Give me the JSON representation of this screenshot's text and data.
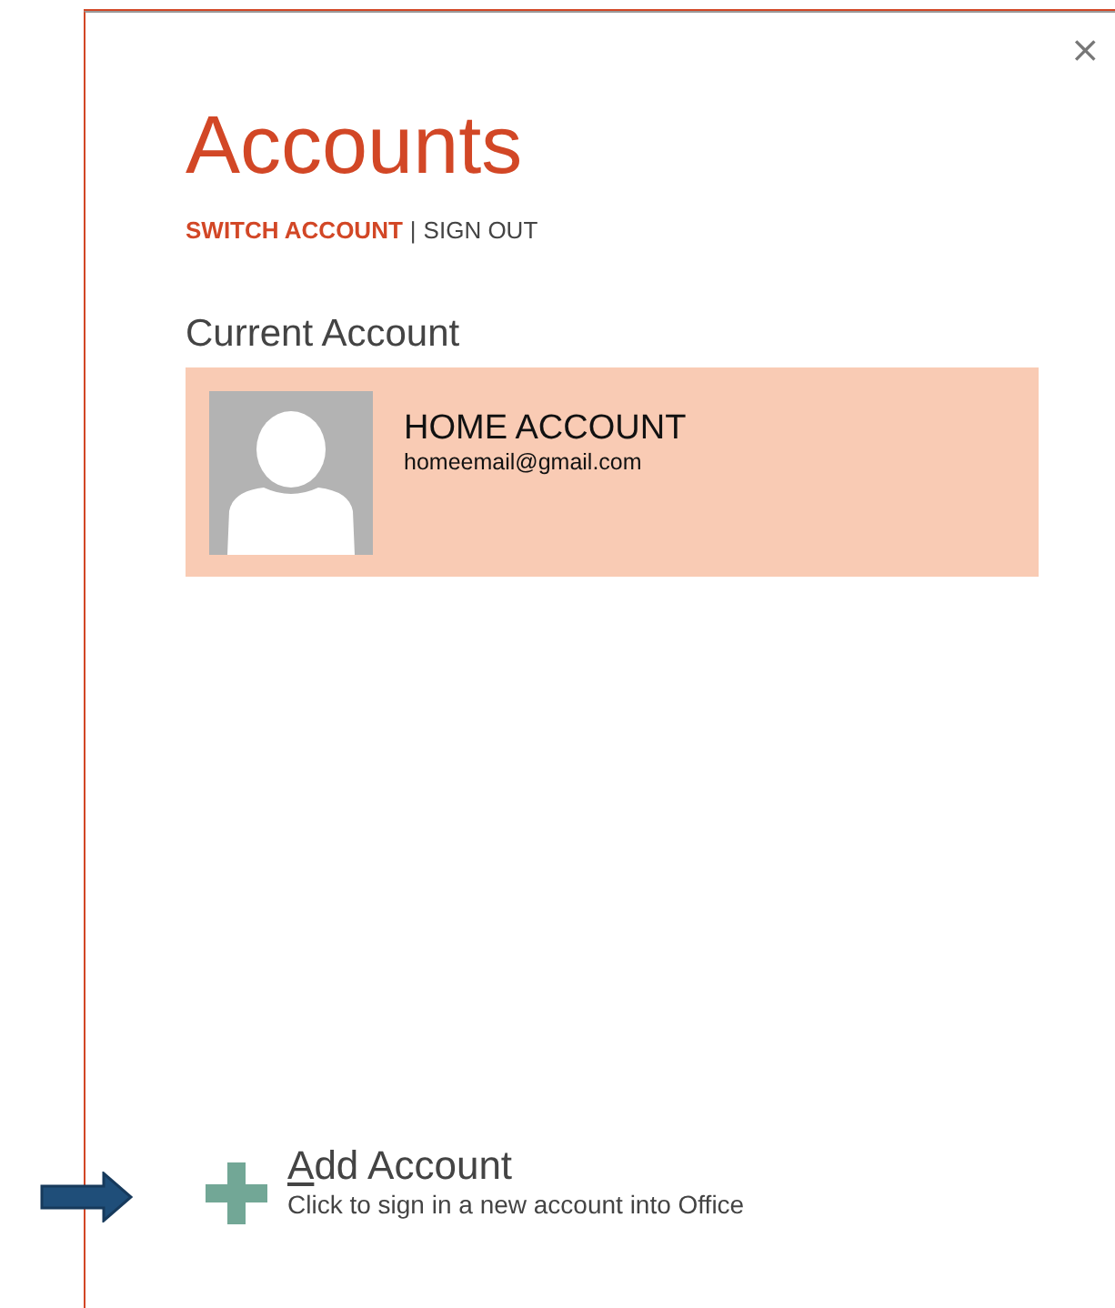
{
  "window": {
    "close": "×"
  },
  "title": "Accounts",
  "links": [
    {
      "label": "SWITCH ACCOUNT",
      "selected": true
    },
    {
      "label": "SIGN OUT",
      "selected": false
    }
  ],
  "link_separator": "|",
  "current_account": {
    "heading": "Current Account",
    "name": "HOME ACCOUNT",
    "email": "homeemail@gmail.com"
  },
  "add_account": {
    "label": "Add Account",
    "description": "Click to sign in a new account into Office"
  }
}
